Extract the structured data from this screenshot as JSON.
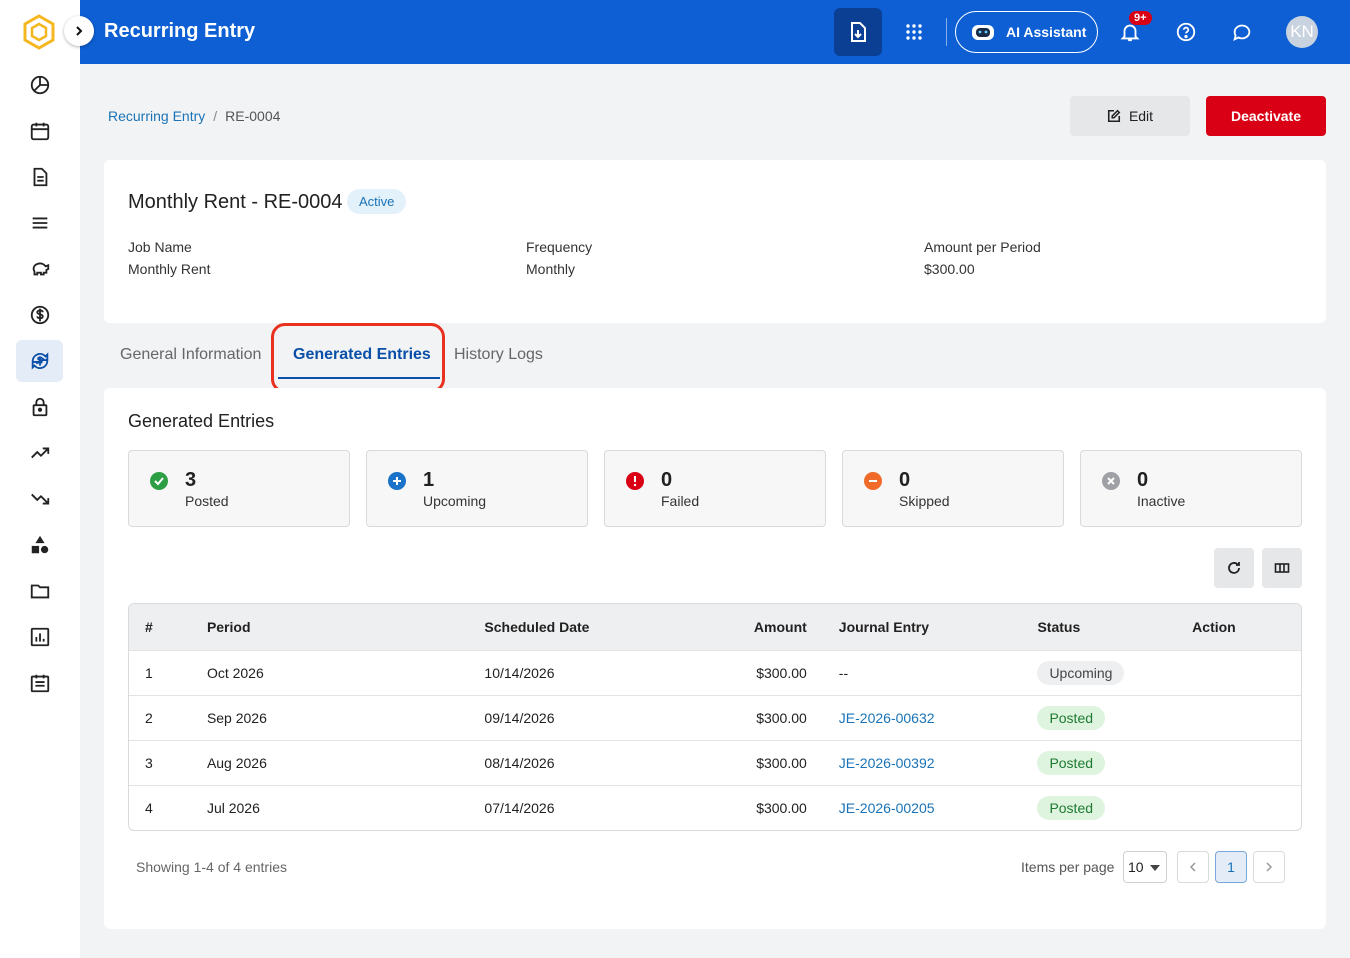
{
  "header": {
    "title": "Recurring Entry",
    "ai_label": "AI Assistant",
    "notif_badge": "9+",
    "avatar": "KN"
  },
  "sidebar": {
    "items": [
      "pie-chart-icon",
      "calendar-icon",
      "document-icon",
      "list-icon",
      "piggy-bank-icon",
      "dollar-icon",
      "recurring-dollar-icon",
      "lock-icon",
      "trending-up-icon",
      "trending-down-icon",
      "shapes-icon",
      "folder-icon",
      "bar-chart-icon",
      "calendar-list-icon"
    ],
    "active_index": 6
  },
  "breadcrumb": {
    "parent": "Recurring Entry",
    "separator": "/",
    "current": "RE-0004"
  },
  "actions": {
    "edit": "Edit",
    "deactivate": "Deactivate"
  },
  "summary": {
    "title": "Monthly Rent - RE-0004",
    "status": "Active",
    "fields": [
      {
        "label": "Job Name",
        "value": "Monthly Rent"
      },
      {
        "label": "Frequency",
        "value": "Monthly"
      },
      {
        "label": "Amount per Period",
        "value": "$300.00"
      }
    ]
  },
  "tabs": [
    "General Information",
    "Generated Entries",
    "History Logs"
  ],
  "active_tab": "Generated Entries",
  "entries": {
    "title": "Generated Entries",
    "stats": [
      {
        "count": "3",
        "label": "Posted",
        "color": "#2e9e44"
      },
      {
        "count": "1",
        "label": "Upcoming",
        "color": "#1a73c9"
      },
      {
        "count": "0",
        "label": "Failed",
        "color": "#d90015"
      },
      {
        "count": "0",
        "label": "Skipped",
        "color": "#f06a2a"
      },
      {
        "count": "0",
        "label": "Inactive",
        "color": "#9ea0a5"
      }
    ],
    "columns": [
      "#",
      "Period",
      "Scheduled Date",
      "Amount",
      "Journal Entry",
      "Status",
      "Action"
    ],
    "rows": [
      {
        "num": "1",
        "period": "Oct 2026",
        "date": "10/14/2026",
        "amount": "$300.00",
        "je": "--",
        "status": "Upcoming"
      },
      {
        "num": "2",
        "period": "Sep 2026",
        "date": "09/14/2026",
        "amount": "$300.00",
        "je": "JE-2026-00632",
        "status": "Posted"
      },
      {
        "num": "3",
        "period": "Aug 2026",
        "date": "08/14/2026",
        "amount": "$300.00",
        "je": "JE-2026-00392",
        "status": "Posted"
      },
      {
        "num": "4",
        "period": "Jul 2026",
        "date": "07/14/2026",
        "amount": "$300.00",
        "je": "JE-2026-00205",
        "status": "Posted"
      }
    ]
  },
  "pagination": {
    "showing": "Showing 1-4 of 4 entries",
    "items_per_page_label": "Items per page",
    "items_per_page": "10",
    "current_page": "1"
  }
}
